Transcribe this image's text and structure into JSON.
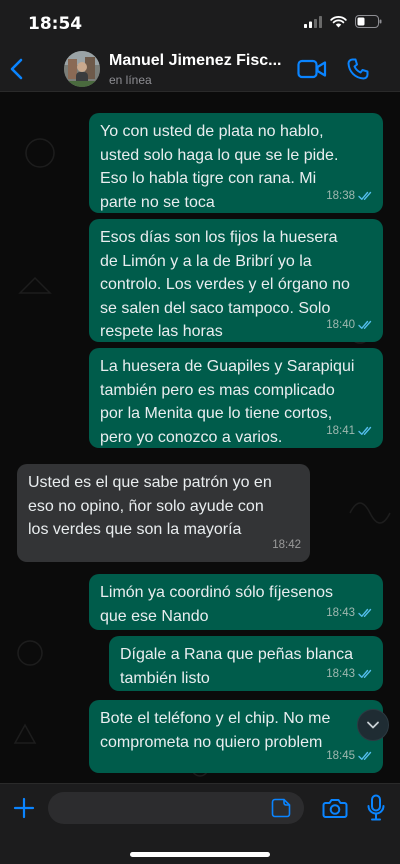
{
  "status_bar": {
    "time": "18:54"
  },
  "header": {
    "back_icon": "chevron-left-icon",
    "contact_name": "Manuel Jimenez Fisc...",
    "contact_status": "en línea",
    "video_icon": "video-camera-icon",
    "call_icon": "phone-icon"
  },
  "messages": [
    {
      "direction": "outgoing",
      "text": "Yo con usted de plata no hablo,\nusted solo haga lo que se le pide.\nEso lo habla tigre con rana. Mi\nparte no se toca",
      "time": "18:38",
      "read": true
    },
    {
      "direction": "outgoing",
      "text": "Esos días son los fijos la huesera\nde Limón y a la de Bribrí yo la\ncontrolo. Los verdes y el órgano no\nse salen del saco tampoco. Solo\nrespete las horas",
      "time": "18:40",
      "read": true
    },
    {
      "direction": "outgoing",
      "text": "La huesera de Guapiles y Sarapiqui\ntambién pero es mas complicado\npor la Menita que lo tiene cortos,\npero yo conozco a varios.",
      "time": "18:41",
      "read": true
    },
    {
      "direction": "incoming",
      "text": "Usted es el que sabe patrón yo en\neso  no opino, ñor solo ayude con\nlos verdes que son la mayoría",
      "time": "18:42",
      "read": false
    },
    {
      "direction": "outgoing",
      "text": "Limón ya coordinó sólo fíjesenos\nque ese Nando",
      "time": "18:43",
      "read": true
    },
    {
      "direction": "outgoing",
      "text": "Dígale a Rana que peñas blanca\ntambién listo",
      "time": "18:43",
      "read": true
    },
    {
      "direction": "outgoing",
      "text": "Bote el teléfono y el chip. No me\ncomprometa no quiero problem",
      "time": "18:45",
      "read": true
    }
  ],
  "scroll_down_icon": "chevron-down-icon",
  "input_bar": {
    "plus_icon": "plus-icon",
    "placeholder": "",
    "sticker_icon": "sticker-icon",
    "camera_icon": "camera-icon",
    "mic_icon": "microphone-icon"
  },
  "colors": {
    "outgoing_bubble": "#005c4b",
    "incoming_bubble": "#333436",
    "accent": "#0a84ff",
    "read_ticks": "#53bdeb"
  }
}
